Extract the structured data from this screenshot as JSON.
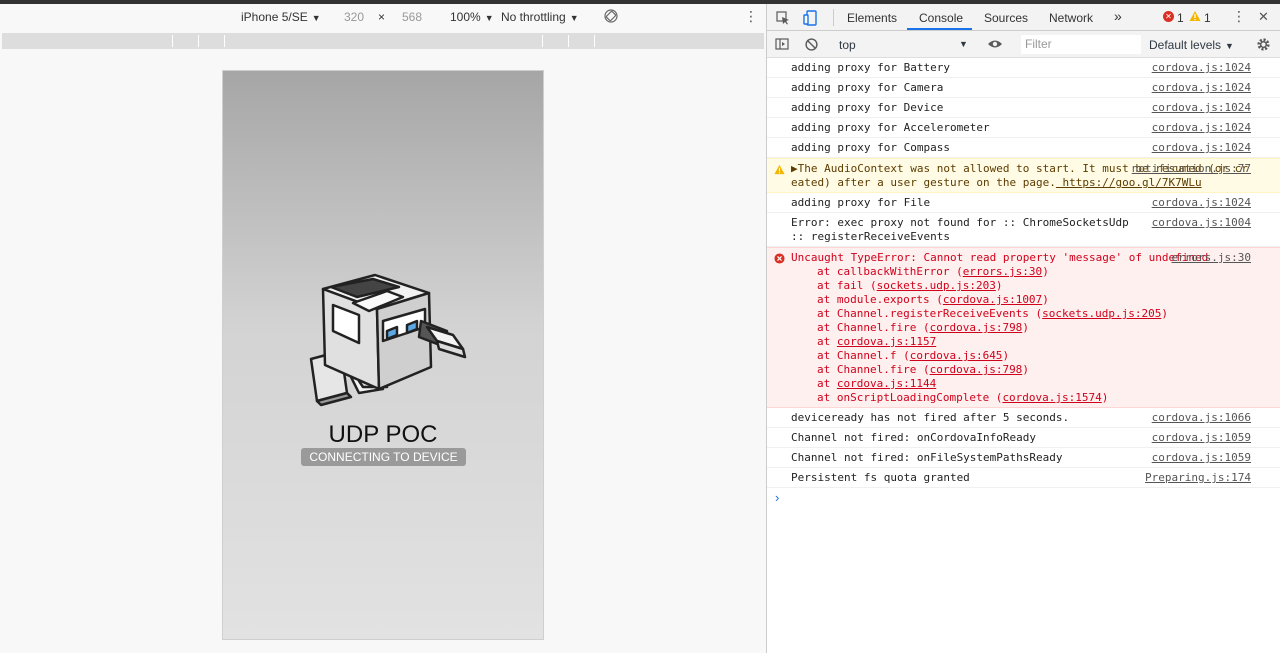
{
  "device_toolbar": {
    "device": "iPhone 5/SE",
    "width": "320",
    "times": "×",
    "height": "568",
    "zoom": "100%",
    "throttle": "No throttling",
    "rotate_icon": "rotate-icon",
    "more_icon": "more-vert-icon"
  },
  "app": {
    "title": "UDP POC",
    "status": "CONNECTING TO DEVICE"
  },
  "devtools": {
    "tabs": [
      "Elements",
      "Console",
      "Sources",
      "Network"
    ],
    "active_tab": "Console",
    "overflow": "»",
    "error_count": "1",
    "warning_count": "1",
    "close": "✕"
  },
  "console_toolbar": {
    "context": "top",
    "filter_placeholder": "Filter",
    "levels": "Default levels"
  },
  "log": [
    {
      "type": "info",
      "msg": "adding proxy for Battery",
      "src": "cordova.js:1024"
    },
    {
      "type": "info",
      "msg": "adding proxy for Camera",
      "src": "cordova.js:1024"
    },
    {
      "type": "info",
      "msg": "adding proxy for Device",
      "src": "cordova.js:1024"
    },
    {
      "type": "info",
      "msg": "adding proxy for Accelerometer",
      "src": "cordova.js:1024"
    },
    {
      "type": "info",
      "msg": "adding proxy for Compass",
      "src": "cordova.js:1024"
    },
    {
      "type": "warn",
      "msg": "▶The AudioContext was not allowed to start. It must be resumed (or created) after a user gesture on the page.",
      "link": "https://goo.gl/7K7WLu",
      "src": "notification.js:77"
    },
    {
      "type": "info",
      "msg": "adding proxy for File",
      "src": "cordova.js:1024"
    },
    {
      "type": "info",
      "msg": "Error: exec proxy not found for :: ChromeSocketsUdp :: registerReceiveEvents",
      "src": "cordova.js:1004"
    },
    {
      "type": "error",
      "msg": "Uncaught TypeError: Cannot read property 'message' of undefined",
      "src": "errors.js:30",
      "stack": [
        {
          "pre": "at callbackWithError (",
          "link": "errors.js:30",
          "post": ")"
        },
        {
          "pre": "at fail (",
          "link": "sockets.udp.js:203",
          "post": ")"
        },
        {
          "pre": "at module.exports (",
          "link": "cordova.js:1007",
          "post": ")"
        },
        {
          "pre": "at Channel.registerReceiveEvents (",
          "link": "sockets.udp.js:205",
          "post": ")"
        },
        {
          "pre": "at Channel.fire (",
          "link": "cordova.js:798",
          "post": ")"
        },
        {
          "pre": "at ",
          "link": "cordova.js:1157",
          "post": ""
        },
        {
          "pre": "at Channel.f (",
          "link": "cordova.js:645",
          "post": ")"
        },
        {
          "pre": "at Channel.fire (",
          "link": "cordova.js:798",
          "post": ")"
        },
        {
          "pre": "at ",
          "link": "cordova.js:1144",
          "post": ""
        },
        {
          "pre": "at onScriptLoadingComplete (",
          "link": "cordova.js:1574",
          "post": ")"
        }
      ]
    },
    {
      "type": "info",
      "msg": "deviceready has not fired after 5 seconds.",
      "src": "cordova.js:1066"
    },
    {
      "type": "info",
      "msg": "Channel not fired: onCordovaInfoReady",
      "src": "cordova.js:1059"
    },
    {
      "type": "info",
      "msg": "Channel not fired: onFileSystemPathsReady",
      "src": "cordova.js:1059"
    },
    {
      "type": "info",
      "msg": "Persistent fs quota granted",
      "src": "Preparing.js:174"
    }
  ],
  "prompt": "›"
}
